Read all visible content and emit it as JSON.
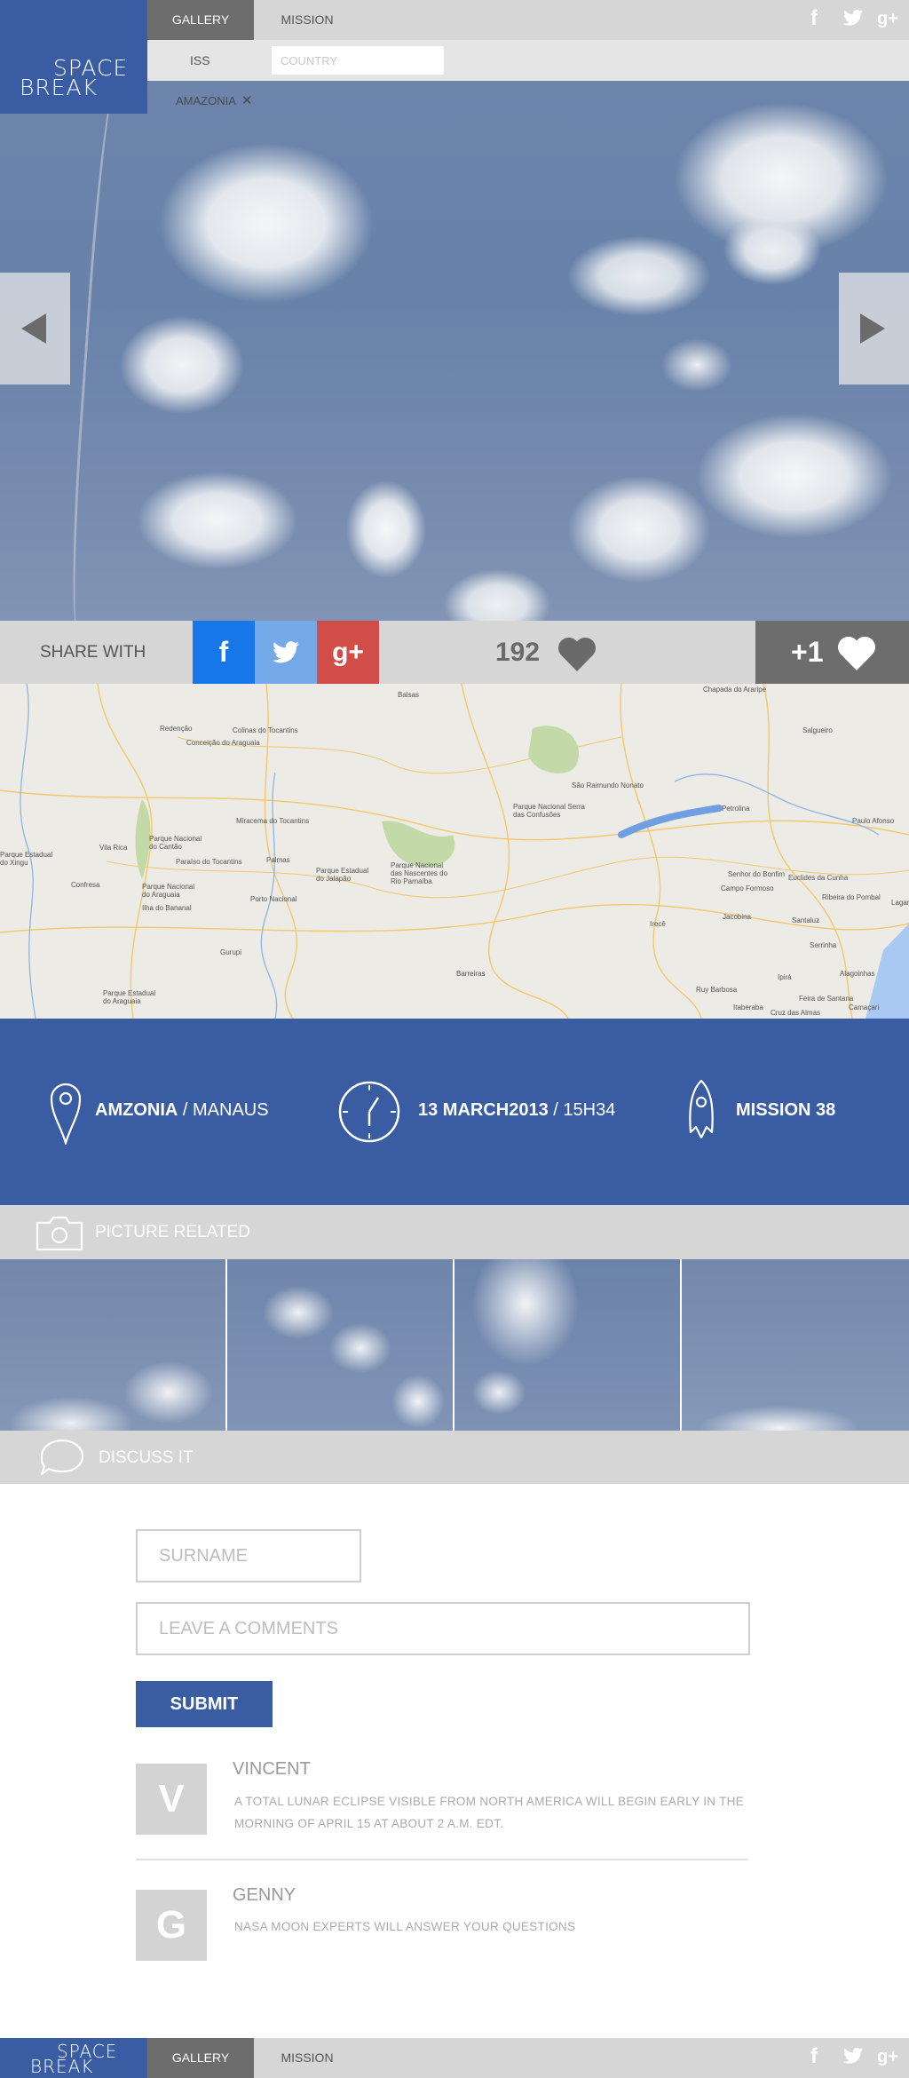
{
  "brand": {
    "logo_line1": "SPACE",
    "logo_line2": "BREAK",
    "color": "#3a5ca3"
  },
  "nav": {
    "tabs": [
      {
        "label": "GALLERY",
        "active": true
      },
      {
        "label": "MISSION",
        "active": false
      }
    ]
  },
  "social_icons": [
    "facebook-icon",
    "twitter-icon",
    "google-plus-icon"
  ],
  "filter": {
    "source_label": "ISS",
    "country_placeholder": "COUNTRY",
    "tag": "AMAZONIA",
    "tag_remove": "✕"
  },
  "hero": {
    "prev_icon": "chevron-left-icon",
    "next_icon": "chevron-right-icon"
  },
  "share": {
    "label": "SHARE WITH",
    "buttons": [
      {
        "glyph": "f",
        "color": "#1877e8"
      },
      {
        "glyph": "twitter-bird",
        "color": "#74a9e9"
      },
      {
        "glyph": "g+",
        "color": "#d24c48"
      }
    ],
    "likes": "192",
    "plus_one": "+1"
  },
  "map": {
    "labels": [
      "Chapada do Araripe",
      "Balsas",
      "Redenção",
      "Colinas do Tocantins",
      "Conceição do Araguaia",
      "Salgueiro",
      "São Raimundo Nonato",
      "Parque Nacional Serra das Confusões",
      "Petrolina",
      "Paulo Afonso",
      "Parque Estadual do Xingu",
      "Vila Rica",
      "Parque Nacional do Cantão",
      "Miracema do Tocantins",
      "Paraíso do Tocantins",
      "Palmas",
      "Parque Estadual do Jalapão",
      "Parque Nacional das Nascentes do Rio Parnaíba",
      "Senhor do Bonfim",
      "Campo Formoso",
      "Euclides da Cunha",
      "Ribeira do Pombal",
      "Confresa",
      "Parque Nacional do Araguaia",
      "Ilha do Bananal",
      "Porto Nacional",
      "Jacobina",
      "Santaluz",
      "Serrinha",
      "Irecê",
      "Gurupi",
      "Barreiras",
      "Parque Estadual do Araguaia",
      "Ruy Barbosa",
      "Feira de Santana",
      "Alagoinhas",
      "Itaberaba",
      "Cruz das Almas",
      "Camaçari",
      "Lagarto",
      "Ipirá"
    ]
  },
  "info": {
    "location_bold": "AMZONIA",
    "location_rest": " / MANAUS",
    "date_bold": "13 MARCH2013",
    "date_rest": " / 15H34",
    "mission": "MISSION 38"
  },
  "related": {
    "title": "PICTURE RELATED"
  },
  "discuss": {
    "title": "DISCUSS IT",
    "surname_placeholder": "SURNAME",
    "comment_placeholder": "LEAVE A COMMENTS",
    "submit_label": "SUBMIT"
  },
  "comments": [
    {
      "initial": "V",
      "name": "VINCENT",
      "text": "A TOTAL LUNAR ECLIPSE VISIBLE FROM NORTH AMERICA WILL BEGIN EARLY IN THE MORNING OF APRIL 15 AT ABOUT 2 A.M. EDT."
    },
    {
      "initial": "G",
      "name": "GENNY",
      "text": "NASA MOON EXPERTS WILL ANSWER YOUR QUESTIONS"
    }
  ],
  "footer": {
    "tabs": [
      {
        "label": "GALLERY"
      },
      {
        "label": "MISSION"
      }
    ]
  }
}
